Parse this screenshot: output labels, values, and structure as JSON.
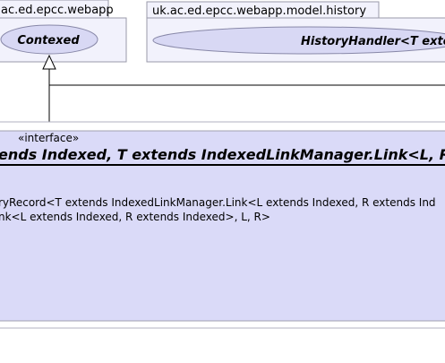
{
  "packages": {
    "left": {
      "name": "ac.ed.epcc.webapp",
      "usecase": "Contexed"
    },
    "right": {
      "name": "uk.ac.ed.epcc.webapp.model.history",
      "usecase": "HistoryHandler<T exte"
    }
  },
  "main_class": {
    "stereotype": "«interface»",
    "title": "ends Indexed, T extends IndexedLinkManager.Link<L, R",
    "members": [
      "ryRecord<T extends IndexedLinkManager.Link<L extends Indexed, R extends Ind",
      "nk<L extends Indexed, R extends Indexed>, L, R>"
    ]
  },
  "colors": {
    "package_fill": "#f2f2fc",
    "package_stroke": "#9a9aaa",
    "oval_fill": "#d8d8f4",
    "class_fill": "#dadaf8",
    "class_stroke": "#a0a0b0"
  }
}
